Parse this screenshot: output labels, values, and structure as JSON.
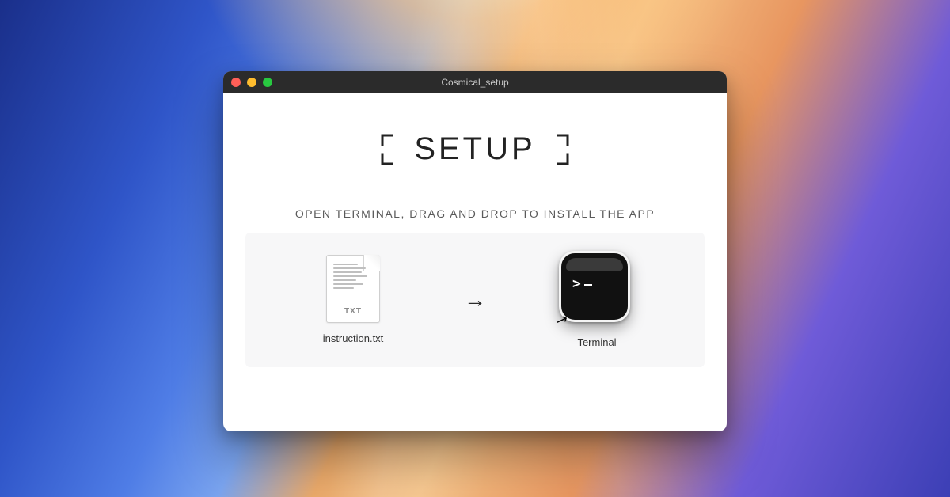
{
  "window": {
    "title": "Cosmical_setup"
  },
  "heading": {
    "text": "SETUP"
  },
  "instruction": "OPEN TERMINAL, DRAG AND DROP TO INSTALL THE APP",
  "source": {
    "filename": "instruction.txt",
    "badge": "TXT"
  },
  "arrow": "→",
  "target": {
    "label": "Terminal",
    "prompt_symbol": ">"
  }
}
